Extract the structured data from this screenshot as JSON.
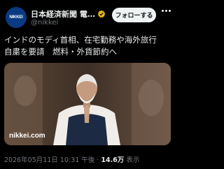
{
  "author": {
    "avatar_text": "NIKKEI",
    "display_name": "日本経済新聞 電…",
    "handle": "@nikkei",
    "verified_icon": "gold-verified-badge-icon"
  },
  "follow_label": "フォローする",
  "more_icon": "more-options-icon",
  "tweet": {
    "line1": "インドのモディ首相、在宅勤務や海外旅行",
    "line2": "自粛を要請　燃料・外貨節約へ"
  },
  "media": {
    "watermark": "nikkei.com"
  },
  "meta": {
    "timestamp": "2026年05月11日 10:31 午後",
    "separator": " · ",
    "views_count": "14.6万",
    "views_label": " 表示"
  },
  "colors": {
    "background": "#000000",
    "text": "#e7e9ea",
    "muted": "#71767b",
    "follow_bg": "#eff3f4",
    "verified_gold": "#e2b719"
  }
}
